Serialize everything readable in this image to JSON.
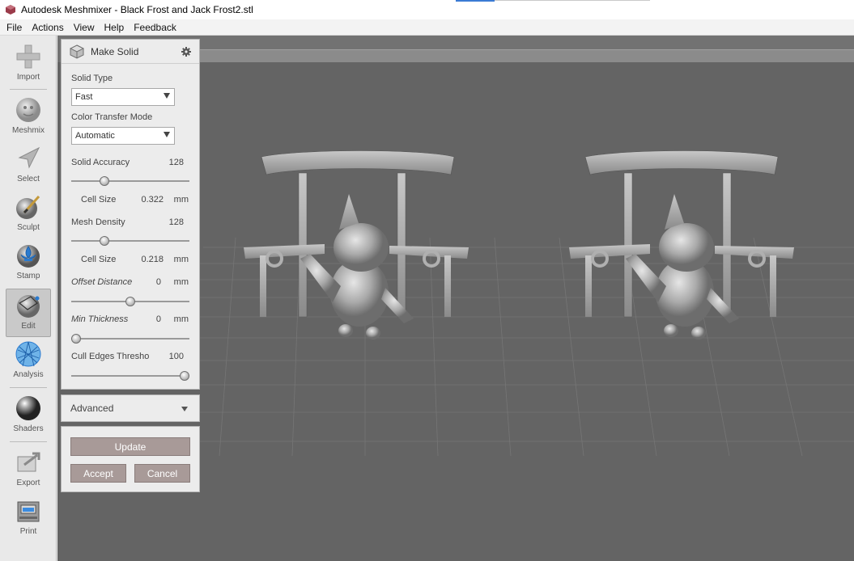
{
  "window": {
    "title": "Autodesk Meshmixer - Black Frost and Jack Frost2.stl"
  },
  "menu": [
    "File",
    "Actions",
    "View",
    "Help",
    "Feedback"
  ],
  "toolbar": {
    "tools": [
      {
        "label": "Import",
        "icon": "plus-icon"
      },
      {
        "label": "Meshmix",
        "icon": "meshmix-ball-icon"
      },
      {
        "label": "Select",
        "icon": "select-arrow-icon"
      },
      {
        "label": "Sculpt",
        "icon": "sculpt-brush-icon"
      },
      {
        "label": "Stamp",
        "icon": "stamp-fleur-icon"
      },
      {
        "label": "Edit",
        "icon": "edit-sphere-icon",
        "active": true
      },
      {
        "label": "Analysis",
        "icon": "analysis-mesh-icon"
      },
      {
        "label": "Shaders",
        "icon": "shader-sphere-icon"
      },
      {
        "label": "Export",
        "icon": "export-icon"
      },
      {
        "label": "Print",
        "icon": "printer-icon"
      }
    ]
  },
  "panel": {
    "title": "Make Solid",
    "solid_type_label": "Solid Type",
    "solid_type_value": "Fast",
    "color_mode_label": "Color Transfer Mode",
    "color_mode_value": "Automatic",
    "solid_accuracy_label": "Solid Accuracy",
    "solid_accuracy_value": "128",
    "solid_accuracy_level": 0.26,
    "cell_size_label": "Cell Size",
    "cell_size_1_value": "0.322",
    "unit": "mm",
    "mesh_density_label": "Mesh Density",
    "mesh_density_value": "128",
    "mesh_density_level": 0.26,
    "cell_size_2_value": "0.218",
    "offset_distance_label": "Offset Distance",
    "offset_distance_value": "0",
    "offset_distance_level": 0.5,
    "min_thickness_label": "Min Thickness",
    "min_thickness_value": "0",
    "min_thickness_level": 0.0,
    "cull_edges_label": "Cull Edges Threshold",
    "cull_edges_value": "100",
    "cull_edges_level": 1.0
  },
  "advanced": {
    "label": "Advanced"
  },
  "buttons": {
    "update": "Update",
    "accept": "Accept",
    "cancel": "Cancel"
  },
  "colors": {
    "viewport_bg": "#646464",
    "model": "#b7b7b7",
    "button": "#a89a98"
  }
}
